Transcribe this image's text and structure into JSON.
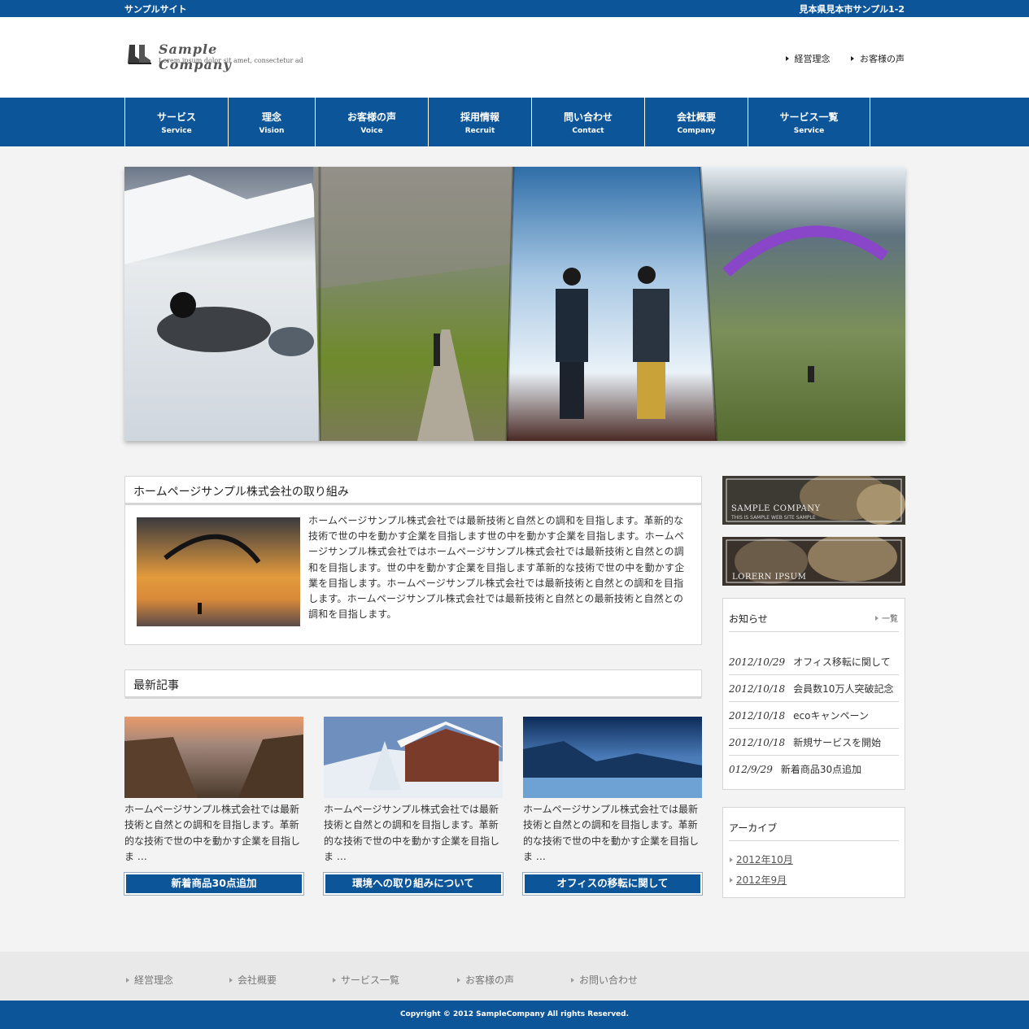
{
  "topbar": {
    "site_name": "サンプルサイト",
    "address": "見本県見本市サンプル1-2"
  },
  "header": {
    "logo_name": "Sample Company",
    "logo_tagline": "Lorem ipsum dolor sit amet, consectetur ad",
    "links": [
      "経営理念",
      "お客様の声"
    ]
  },
  "nav": [
    {
      "jp": "サービス",
      "en": "Service"
    },
    {
      "jp": "理念",
      "en": "Vision"
    },
    {
      "jp": "お客様の声",
      "en": "Voice"
    },
    {
      "jp": "採用情報",
      "en": "Recruit"
    },
    {
      "jp": "問い合わせ",
      "en": "Contact"
    },
    {
      "jp": "会社概要",
      "en": "Company"
    },
    {
      "jp": "サービス一覧",
      "en": "Service"
    }
  ],
  "intro": {
    "title": "ホームページサンプル株式会社の取り組み",
    "text": "ホームページサンプル株式会社では最新技術と自然との調和を目指します。革新的な技術で世の中を動かす企業を目指します世の中を動かす企業を目指します。ホームページサンプル株式会社ではホームページサンプル株式会社では最新技術と自然との調和を目指します。世の中を動かす企業を目指します革新的な技術で世の中を動かす企業を目指します。ホームページサンプル株式会社では最新技術と自然との調和を目指します。ホームページサンプル株式会社では最新技術と自然との最新技術と自然との調和を目指します。"
  },
  "latest": {
    "title": "最新記事",
    "cards": [
      {
        "text": "ホームページサンプル株式会社では最新技術と自然との調和を目指します。革新的な技術で世の中を動かす企業を目指しま …",
        "button": "新着商品30点追加"
      },
      {
        "text": "ホームページサンプル株式会社では最新技術と自然との調和を目指します。革新的な技術で世の中を動かす企業を目指しま …",
        "button": "環境への取り組みについて"
      },
      {
        "text": "ホームページサンプル株式会社では最新技術と自然との調和を目指します。革新的な技術で世の中を動かす企業を目指しま …",
        "button": "オフィスの移転に関して"
      }
    ]
  },
  "sidebar": {
    "banner1": {
      "title": "SAMPLE COMPANY",
      "sub": "THIS IS SAMPLE WEB SITE SAMPLE"
    },
    "banner2": {
      "title": "LORERN IPSUM"
    },
    "news": {
      "title": "お知らせ",
      "more": "一覧",
      "items": [
        {
          "date": "2012/10/29",
          "text": "オフィス移転に関して"
        },
        {
          "date": "2012/10/18",
          "text": "会員数10万人突破記念"
        },
        {
          "date": "2012/10/18",
          "text": "ecoキャンペーン"
        },
        {
          "date": "2012/10/18",
          "text": "新規サービスを開始"
        },
        {
          "date": "012/9/29",
          "text": "新着商品30点追加"
        }
      ]
    },
    "archive": {
      "title": "アーカイブ",
      "items": [
        "2012年10月",
        "2012年9月"
      ]
    }
  },
  "footer": {
    "links": [
      "経営理念",
      "会社概要",
      "サービス一覧",
      "お客様の声",
      "お問い合わせ"
    ],
    "copyright": "Copyright © 2012 SampleCompany All rights Reserved."
  }
}
